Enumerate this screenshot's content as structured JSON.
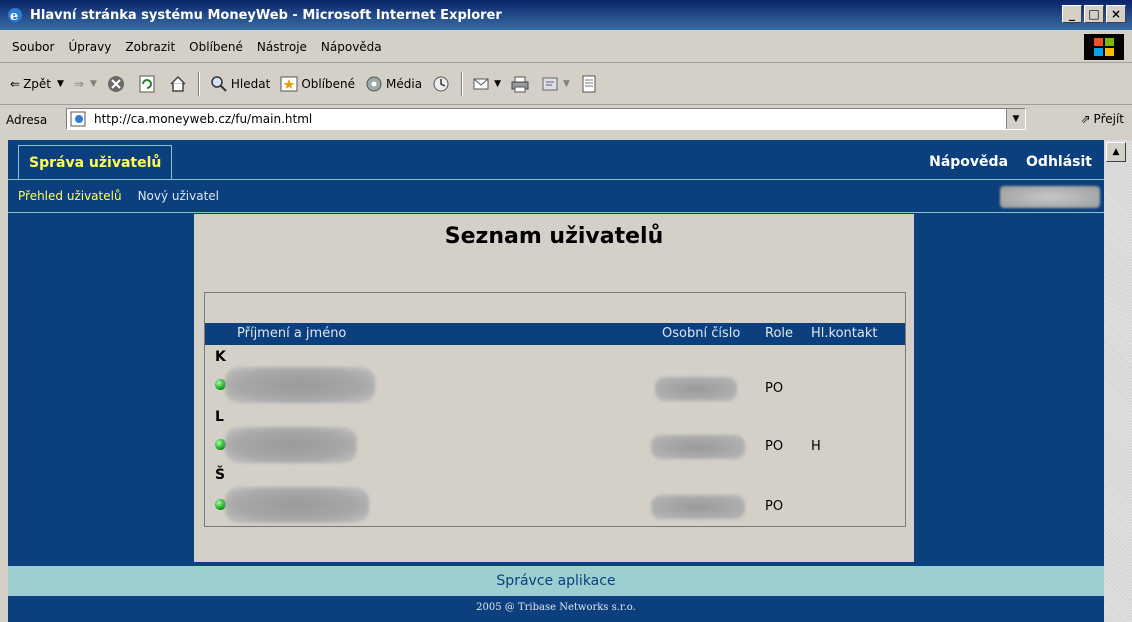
{
  "window": {
    "title": "Hlavní stránka systému MoneyWeb - Microsoft Internet Explorer",
    "min": "_",
    "max": "□",
    "close": "×"
  },
  "menu": [
    "Soubor",
    "Úpravy",
    "Zobrazit",
    "Oblíbené",
    "Nástroje",
    "Nápověda"
  ],
  "toolbar": {
    "back": "Zpět",
    "search": "Hledat",
    "favorites": "Oblíbené",
    "media": "Média"
  },
  "address": {
    "label": "Adresa",
    "url": "http://ca.moneyweb.cz/fu/main.html",
    "go": "Přejít"
  },
  "app": {
    "active_tab": "Správa uživatelů",
    "help": "Nápověda",
    "logout": "Odhlásit",
    "subnav": [
      "Přehled uživatelů",
      "Nový uživatel"
    ],
    "heading": "Seznam uživatelů",
    "columns": {
      "name": "Příjmení a jméno",
      "number": "Osobní číslo",
      "role": "Role",
      "contact": "Hl.kontakt"
    },
    "groups": [
      {
        "letter": "K",
        "role": "PO",
        "contact": ""
      },
      {
        "letter": "L",
        "role": "PO",
        "contact": "H"
      },
      {
        "letter": "Š",
        "role": "PO",
        "contact": ""
      }
    ],
    "footer": "Správce aplikace",
    "copyright": "2005 @ Tribase Networks s.r.o."
  },
  "colors": {
    "page_bg": "#0c3f7e",
    "accent": "#ffff55",
    "footer_bg": "#9ccfcf",
    "status_ok": "#16a016"
  }
}
